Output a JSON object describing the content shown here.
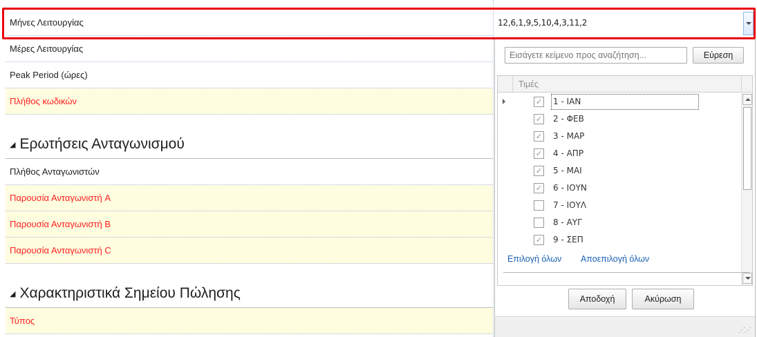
{
  "form": {
    "field_operating_months": "Μήνες Λειτουργίας",
    "field_operating_days": "Μέρες Λειτουργίας",
    "field_peak_period": "Peak Period (ώρες)",
    "field_code_count": "Πλήθος κωδικών",
    "section_competition": "Ερωτήσεις Ανταγωνισμού",
    "field_competitor_count": "Πλήθος Ανταγωνιστών",
    "field_competitor_a": "Παρουσία Ανταγωνιστή A",
    "field_competitor_b": "Παρουσία Ανταγωνιστή B",
    "field_competitor_c": "Παρουσία Ανταγωνιστή C",
    "section_pos": "Χαρακτηριστικά Σημείου Πώλησης",
    "field_type": "Τύπος"
  },
  "combo": {
    "value": "12,6,1,9,5,10,4,3,11,2"
  },
  "popup": {
    "search_placeholder": "Εισάγετε κείμενο προς αναζήτηση...",
    "search_button": "Εύρεση",
    "column_header": "Τιμές",
    "items": [
      {
        "label": "1 - ΙΑΝ",
        "checked": true
      },
      {
        "label": "2 - ΦΕΒ",
        "checked": true
      },
      {
        "label": "3 - ΜΑΡ",
        "checked": true
      },
      {
        "label": "4 - ΑΠΡ",
        "checked": true
      },
      {
        "label": "5 - ΜΑΙ",
        "checked": true
      },
      {
        "label": "6 - ΙΟΥΝ",
        "checked": true
      },
      {
        "label": "7 - ΙΟΥΛ",
        "checked": false
      },
      {
        "label": "8 - ΑΥΓ",
        "checked": false
      },
      {
        "label": "9 - ΣΕΠ",
        "checked": true
      }
    ],
    "select_all": "Επιλογή όλων",
    "deselect_all": "Αποεπιλογή όλων",
    "accept_button": "Αποδοχή",
    "cancel_button": "Ακύρωση"
  }
}
